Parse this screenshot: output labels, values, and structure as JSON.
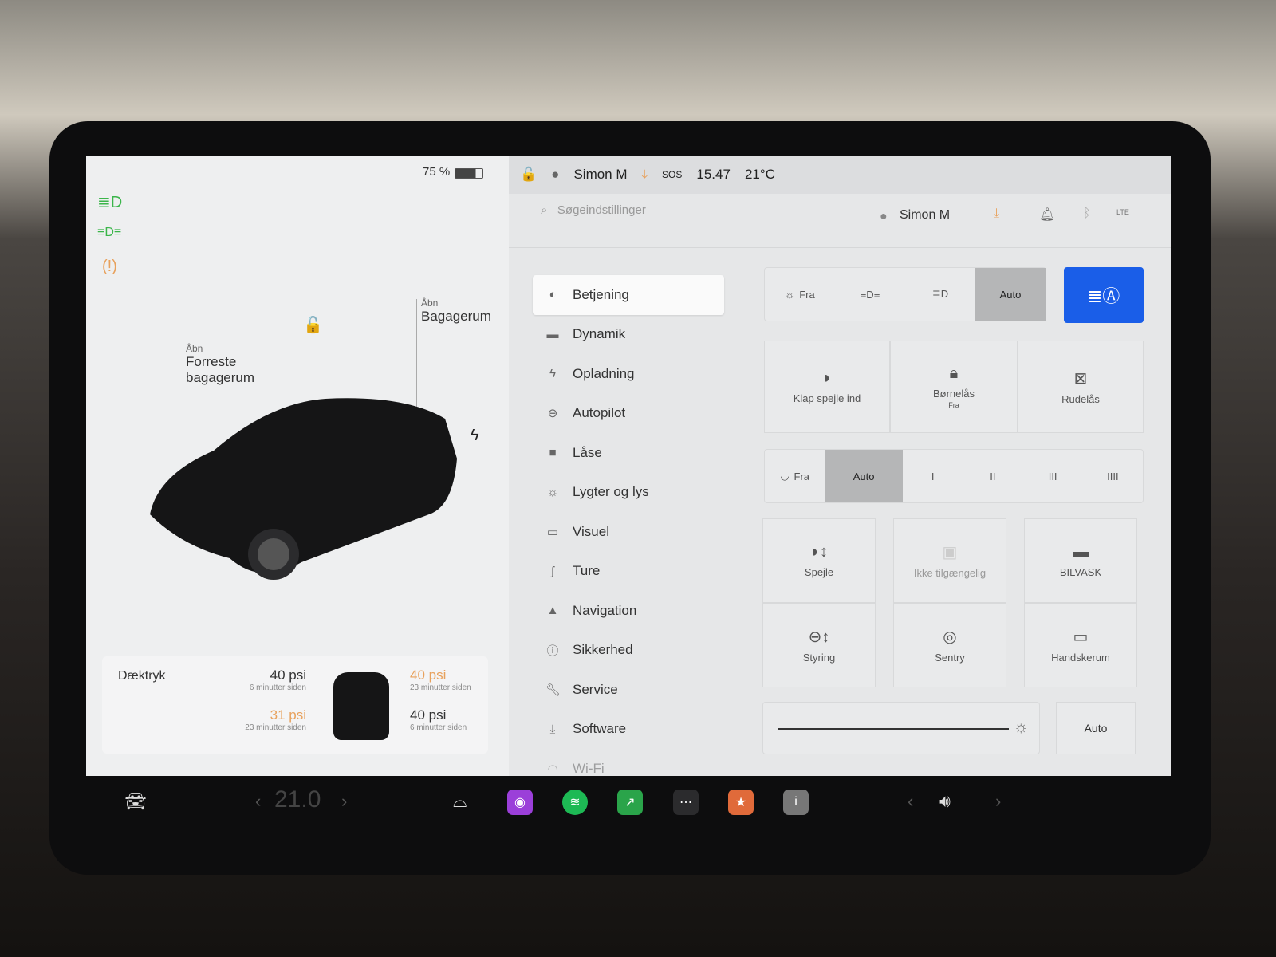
{
  "left": {
    "battery": "75 %",
    "frunk": {
      "label_top": "Åbn",
      "label": "Forreste bagagerum"
    },
    "trunk": {
      "label_top": "Åbn",
      "label": "Bagagerum"
    },
    "tires": {
      "title": "Dæktryk",
      "fl": {
        "value": "40 psi",
        "time": "6 minutter siden",
        "warn": false
      },
      "fr": {
        "value": "40 psi",
        "time": "23 minutter siden",
        "warn": true
      },
      "rl": {
        "value": "31 psi",
        "time": "23 minutter siden",
        "warn": true
      },
      "rr": {
        "value": "40 psi",
        "time": "6 minutter siden",
        "warn": false
      }
    }
  },
  "status": {
    "user": "Simon M",
    "sos": "SOS",
    "time": "15.47",
    "temp": "21°C"
  },
  "header": {
    "search_placeholder": "Søgeindstillinger",
    "user": "Simon M",
    "lte": "LTE"
  },
  "nav": [
    {
      "label": "Betjening",
      "icon": "toggle-icon",
      "active": true
    },
    {
      "label": "Dynamik",
      "icon": "car-icon"
    },
    {
      "label": "Opladning",
      "icon": "bolt-icon"
    },
    {
      "label": "Autopilot",
      "icon": "steering-wheel-icon"
    },
    {
      "label": "Låse",
      "icon": "lock-icon"
    },
    {
      "label": "Lygter og lys",
      "icon": "sun-icon"
    },
    {
      "label": "Visuel",
      "icon": "display-icon"
    },
    {
      "label": "Ture",
      "icon": "trips-icon"
    },
    {
      "label": "Navigation",
      "icon": "navigation-icon"
    },
    {
      "label": "Sikkerhed",
      "icon": "alert-icon"
    },
    {
      "label": "Service",
      "icon": "wrench-icon"
    },
    {
      "label": "Software",
      "icon": "download-icon"
    },
    {
      "label": "Wi-Fi",
      "icon": "wifi-icon"
    }
  ],
  "controls": {
    "lights": {
      "off": "Fra",
      "auto": "Auto",
      "selected": "Auto"
    },
    "locks": {
      "mirrors": "Klap spejle ind",
      "child": "Børnelås",
      "child_state": "Fra",
      "window": "Rudelås"
    },
    "wipers": {
      "off": "Fra",
      "auto": "Auto",
      "levels": [
        "I",
        "II",
        "III",
        "IIII"
      ],
      "selected": "Auto"
    },
    "tiles": {
      "mirrors": "Spejle",
      "unavailable": "Ikke tilgængelig",
      "carwash": "BILVASK",
      "steering": "Styring",
      "sentry": "Sentry",
      "glovebox": "Handskerum"
    },
    "brightness": {
      "auto": "Auto",
      "level": 0.95
    }
  },
  "dock": {
    "temp": "21.0"
  },
  "colors": {
    "accent": "#1a5ee8",
    "warning": "#e8a15c",
    "green": "#3bb54a"
  }
}
